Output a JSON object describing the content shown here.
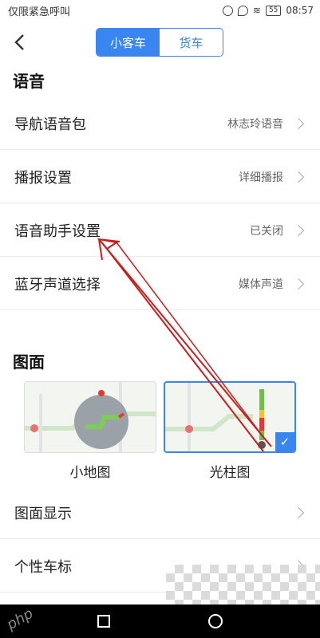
{
  "status_bar": {
    "carrier": "仅限紧急呼叫",
    "battery": "55",
    "time": "08:57"
  },
  "header": {
    "tabs": [
      {
        "label": "小客车",
        "active": true
      },
      {
        "label": "货车",
        "active": false
      }
    ]
  },
  "voice_section": {
    "title": "语音",
    "rows": [
      {
        "label": "导航语音包",
        "value": "林志玲语音"
      },
      {
        "label": "播报设置",
        "value": "详细播报"
      },
      {
        "label": "语音助手设置",
        "value": "已关闭"
      },
      {
        "label": "蓝牙声道选择",
        "value": "媒体声道"
      }
    ]
  },
  "display_section": {
    "title": "图面",
    "cards": [
      {
        "label": "小地图",
        "selected": false
      },
      {
        "label": "光柱图",
        "selected": true
      }
    ],
    "rows": [
      {
        "label": "图面显示",
        "value": ""
      },
      {
        "label": "个性车标",
        "value": ""
      }
    ]
  },
  "colors": {
    "accent": "#3a86f0",
    "arrow": "#c81e1e"
  },
  "watermark": "php"
}
